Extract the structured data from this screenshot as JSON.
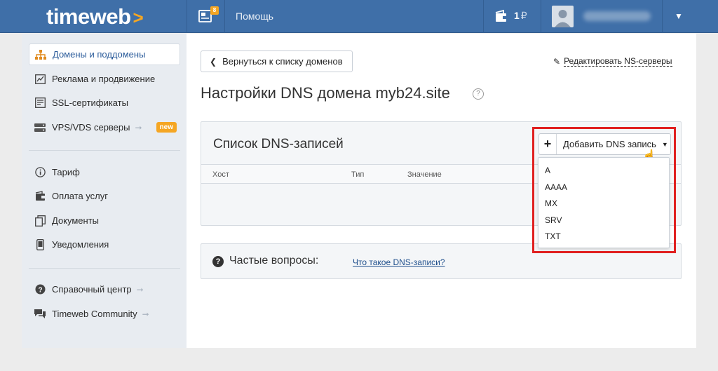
{
  "colors": {
    "topbar": "#3f6fa8",
    "logo_arrow": "#f5a623",
    "badge": "#f5a623",
    "highlight": "#e02020"
  },
  "header": {
    "logo": "timeweb",
    "news_count": "8",
    "help": "Помощь",
    "balance": "1",
    "currency": "₽",
    "icons": {
      "news": "news-icon",
      "wallet": "wallet-icon",
      "avatar": "user-icon",
      "menu": "caret-down-icon"
    }
  },
  "sidebar": {
    "items": [
      {
        "label": "Домены и поддомены",
        "icon": "sitemap-icon"
      },
      {
        "label": "Реклама и продвижение",
        "icon": "chart-icon"
      },
      {
        "label": "SSL-сертификаты",
        "icon": "certificate-icon"
      },
      {
        "label": "VPS/VDS серверы",
        "icon": "server-icon",
        "badge": "new"
      },
      {
        "label": "Тариф",
        "icon": "info-icon"
      },
      {
        "label": "Оплата услуг",
        "icon": "payment-icon"
      },
      {
        "label": "Документы",
        "icon": "documents-icon"
      },
      {
        "label": "Уведомления",
        "icon": "phone-icon"
      },
      {
        "label": "Справочный центр",
        "icon": "help-icon"
      },
      {
        "label": "Timeweb Community",
        "icon": "chat-icon"
      }
    ]
  },
  "main": {
    "back_button": "Вернуться к списку доменов",
    "edit_ns": "Редактировать NS-серверы",
    "title": "Настройки DNS домена myb24.site",
    "dns_panel": {
      "title": "Список DNS-записей",
      "columns": [
        "Хост",
        "Тип",
        "Значение"
      ],
      "add_button": "Добавить DNS запись",
      "record_types": [
        "A",
        "AAAA",
        "MX",
        "SRV",
        "TXT"
      ]
    },
    "faq": {
      "title": "Частые вопросы:",
      "link": "Что такое DNS-записи?"
    }
  }
}
